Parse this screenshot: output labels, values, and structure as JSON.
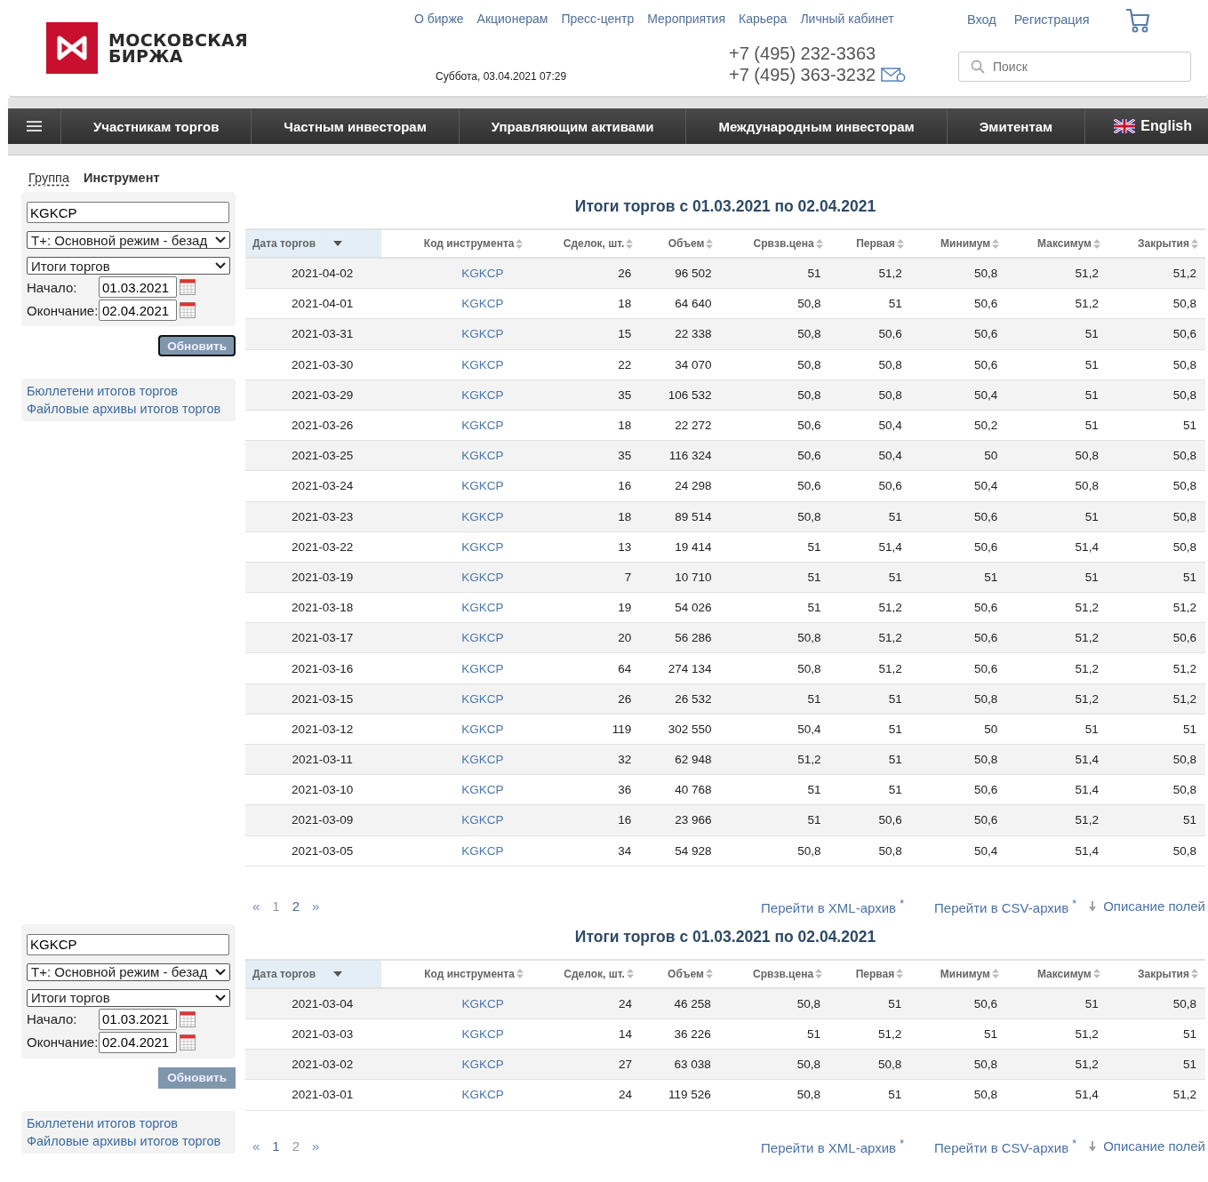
{
  "header": {
    "logo_text": [
      "МОСКОВСКАЯ",
      "БИРЖА"
    ],
    "top_links": [
      "О бирже",
      "Акционерам",
      "Пресс-центр",
      "Мероприятия",
      "Карьера",
      "Личный кабинет"
    ],
    "datetime": "Суббота, 03.04.2021 07:29",
    "phones": [
      "+7 (495) 232-3363",
      "+7 (495) 363-3232"
    ],
    "auth_links": [
      "Вход",
      "Регистрация"
    ],
    "search": {
      "placeholder": "Поиск"
    }
  },
  "nav": {
    "items": [
      "Участникам торгов",
      "Частным инвесторам",
      "Управляющим активами",
      "Международным инвесторам",
      "Эмитентам"
    ],
    "language": "English"
  },
  "tabs": [
    {
      "label": "Группа",
      "selected": false
    },
    {
      "label": "Инструмент",
      "selected": true
    }
  ],
  "sections": [
    {
      "sidebar": {
        "instrument": "KGKCP",
        "mode": "T+: Основной режим - безад",
        "report": "Итоги торгов",
        "start_label": "Начало:",
        "start": "01.03.2021",
        "end_label": "Окончание:",
        "end": "02.04.2021",
        "button": "Обновить",
        "focused": true,
        "links": [
          "Бюллетени итогов торгов",
          "Файловые архивы итогов торгов"
        ]
      },
      "title": "Итоги торгов с 01.03.2021 по 02.04.2021",
      "columns": [
        {
          "label": "Дата торгов",
          "sorted": true,
          "kind": "text"
        },
        {
          "label": "Код инструмента",
          "sorted": false,
          "kind": "link"
        },
        {
          "label": "Сделок, шт.",
          "sorted": false,
          "kind": "text"
        },
        {
          "label": "Объем",
          "sorted": false,
          "kind": "text"
        },
        {
          "label": "Срвзв.цена",
          "sorted": false,
          "kind": "text"
        },
        {
          "label": "Первая",
          "sorted": false,
          "kind": "text"
        },
        {
          "label": "Минимум",
          "sorted": false,
          "kind": "text"
        },
        {
          "label": "Максимум",
          "sorted": false,
          "kind": "text"
        },
        {
          "label": "Закрытия",
          "sorted": false,
          "kind": "text"
        }
      ],
      "rows": [
        [
          "2021-04-02",
          "KGKCP",
          "26",
          "96 502",
          "51",
          "51,2",
          "50,8",
          "51,2",
          "51,2"
        ],
        [
          "2021-04-01",
          "KGKCP",
          "18",
          "64 640",
          "50,8",
          "51",
          "50,6",
          "51,2",
          "50,8"
        ],
        [
          "2021-03-31",
          "KGKCP",
          "15",
          "22 338",
          "50,8",
          "50,6",
          "50,6",
          "51",
          "50,6"
        ],
        [
          "2021-03-30",
          "KGKCP",
          "22",
          "34 070",
          "50,8",
          "50,8",
          "50,6",
          "51",
          "50,8"
        ],
        [
          "2021-03-29",
          "KGKCP",
          "35",
          "106 532",
          "50,8",
          "50,8",
          "50,4",
          "51",
          "50,8"
        ],
        [
          "2021-03-26",
          "KGKCP",
          "18",
          "22 272",
          "50,6",
          "50,4",
          "50,2",
          "51",
          "51"
        ],
        [
          "2021-03-25",
          "KGKCP",
          "35",
          "116 324",
          "50,6",
          "50,4",
          "50",
          "50,8",
          "50,8"
        ],
        [
          "2021-03-24",
          "KGKCP",
          "16",
          "24 298",
          "50,6",
          "50,6",
          "50,4",
          "50,8",
          "50,8"
        ],
        [
          "2021-03-23",
          "KGKCP",
          "18",
          "89 514",
          "50,8",
          "51",
          "50,6",
          "51",
          "50,8"
        ],
        [
          "2021-03-22",
          "KGKCP",
          "13",
          "19 414",
          "51",
          "51,4",
          "50,6",
          "51,4",
          "50,8"
        ],
        [
          "2021-03-19",
          "KGKCP",
          "7",
          "10 710",
          "51",
          "51",
          "51",
          "51",
          "51"
        ],
        [
          "2021-03-18",
          "KGKCP",
          "19",
          "54 026",
          "51",
          "51,2",
          "50,6",
          "51,2",
          "51,2"
        ],
        [
          "2021-03-17",
          "KGKCP",
          "20",
          "56 286",
          "50,8",
          "51,2",
          "50,6",
          "51,2",
          "50,6"
        ],
        [
          "2021-03-16",
          "KGKCP",
          "64",
          "274 134",
          "50,8",
          "51,2",
          "50,6",
          "51,2",
          "51,2"
        ],
        [
          "2021-03-15",
          "KGKCP",
          "26",
          "26 532",
          "51",
          "51",
          "50,8",
          "51,2",
          "51,2"
        ],
        [
          "2021-03-12",
          "KGKCP",
          "119",
          "302 550",
          "50,4",
          "51",
          "50",
          "51",
          "51"
        ],
        [
          "2021-03-11",
          "KGKCP",
          "32",
          "62 948",
          "51,2",
          "51",
          "50,8",
          "51,4",
          "50,8"
        ],
        [
          "2021-03-10",
          "KGKCP",
          "36",
          "40 768",
          "51",
          "51",
          "50,6",
          "51,4",
          "50,8"
        ],
        [
          "2021-03-09",
          "KGKCP",
          "16",
          "23 966",
          "51",
          "50,6",
          "50,6",
          "51,2",
          "51"
        ],
        [
          "2021-03-05",
          "KGKCP",
          "34",
          "54 928",
          "50,8",
          "50,8",
          "50,4",
          "51,4",
          "50,8"
        ]
      ],
      "pagination": {
        "prev": "«",
        "pages": [
          {
            "label": "1",
            "selected": true
          },
          {
            "label": "2",
            "selected": false
          }
        ],
        "next": "»"
      },
      "footer_links": [
        {
          "text": "Перейти в XML-архив $^{*}$",
          "kind": "link"
        },
        {
          "text": "Перейти в CSV-архив $^{*}$",
          "kind": "link"
        },
        {
          "text": "Описание полей",
          "kind": "download"
        }
      ]
    },
    {
      "sidebar": {
        "instrument": "KGKCP",
        "mode": "T+: Основной режим - безад",
        "report": "Итоги торгов",
        "start_label": "Начало:",
        "start": "01.03.2021",
        "end_label": "Окончание:",
        "end": "02.04.2021",
        "button": "Обновить",
        "focused": false,
        "links": [
          "Бюллетени итогов торгов",
          "Файловые архивы итогов торгов"
        ]
      },
      "title": "Итоги торгов с 01.03.2021 по 02.04.2021",
      "columns": [
        {
          "label": "Дата торгов",
          "sorted": true,
          "kind": "text"
        },
        {
          "label": "Код инструмента",
          "sorted": false,
          "kind": "link"
        },
        {
          "label": "Сделок, шт.",
          "sorted": false,
          "kind": "text"
        },
        {
          "label": "Объем",
          "sorted": false,
          "kind": "text"
        },
        {
          "label": "Срвзв.цена",
          "sorted": false,
          "kind": "text"
        },
        {
          "label": "Первая",
          "sorted": false,
          "kind": "text"
        },
        {
          "label": "Минимум",
          "sorted": false,
          "kind": "text"
        },
        {
          "label": "Максимум",
          "sorted": false,
          "kind": "text"
        },
        {
          "label": "Закрытия",
          "sorted": false,
          "kind": "text"
        }
      ],
      "rows": [
        [
          "2021-03-04",
          "KGKCP",
          "24",
          "46 258",
          "50,8",
          "51",
          "50,6",
          "51",
          "50,8"
        ],
        [
          "2021-03-03",
          "KGKCP",
          "14",
          "36 226",
          "51",
          "51,2",
          "51",
          "51,2",
          "51"
        ],
        [
          "2021-03-02",
          "KGKCP",
          "27",
          "63 038",
          "50,8",
          "50,8",
          "50,8",
          "51,2",
          "51"
        ],
        [
          "2021-03-01",
          "KGKCP",
          "24",
          "119 526",
          "50,8",
          "51",
          "50,8",
          "51,4",
          "51,2"
        ]
      ],
      "pagination": {
        "prev": "«",
        "pages": [
          {
            "label": "1",
            "selected": false
          },
          {
            "label": "2",
            "selected": true
          }
        ],
        "next": "»"
      },
      "footer_links": [
        {
          "text": "Перейти в XML-архив $^{*}$",
          "kind": "link"
        },
        {
          "text": "Перейти в CSV-архив $^{*}$",
          "kind": "link"
        },
        {
          "text": "Описание полей",
          "kind": "download"
        }
      ]
    }
  ]
}
